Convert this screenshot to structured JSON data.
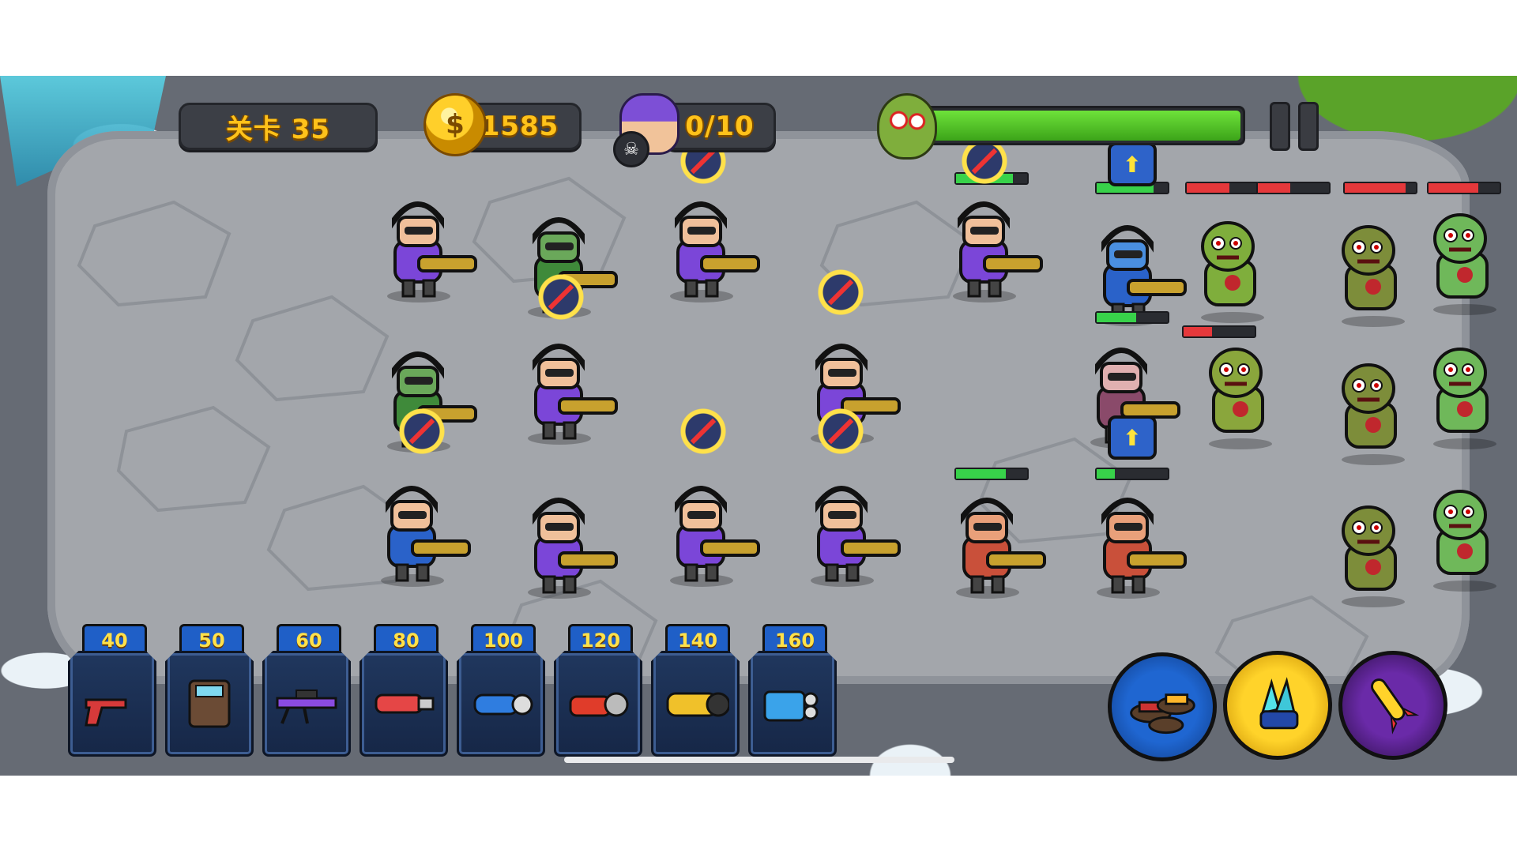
{
  "hud": {
    "level_label": "关卡 35",
    "coins": "1585",
    "kills": "0/10",
    "wave_progress_percent": 100
  },
  "icons": {
    "coin": "coin-icon",
    "kill_counter": "soldier-head-icon",
    "skull": "skull-icon",
    "wave": "zombie-face-icon",
    "pause": "pause-icon"
  },
  "shop": {
    "weapons": [
      {
        "price": "40",
        "icon": "pistol-icon"
      },
      {
        "price": "50",
        "icon": "riot-shield-icon"
      },
      {
        "price": "60",
        "icon": "sniper-rifle-icon"
      },
      {
        "price": "80",
        "icon": "blaster-icon"
      },
      {
        "price": "100",
        "icon": "minigun-icon"
      },
      {
        "price": "120",
        "icon": "grenade-launcher-icon"
      },
      {
        "price": "140",
        "icon": "cannon-icon"
      },
      {
        "price": "160",
        "icon": "double-barrel-icon"
      }
    ]
  },
  "skills": [
    {
      "name": "mines",
      "icon": "landmine-skill-icon"
    },
    {
      "name": "crystal",
      "icon": "crystal-turret-skill-icon"
    },
    {
      "name": "missile",
      "icon": "missile-strike-skill-icon"
    }
  ],
  "colors": {
    "gold_text": "#ffc21a",
    "hud_bg": "#3c3f46",
    "hp_green": "#38d24a",
    "hp_red": "#e5383b",
    "card_blue": "#1f5fc7"
  }
}
